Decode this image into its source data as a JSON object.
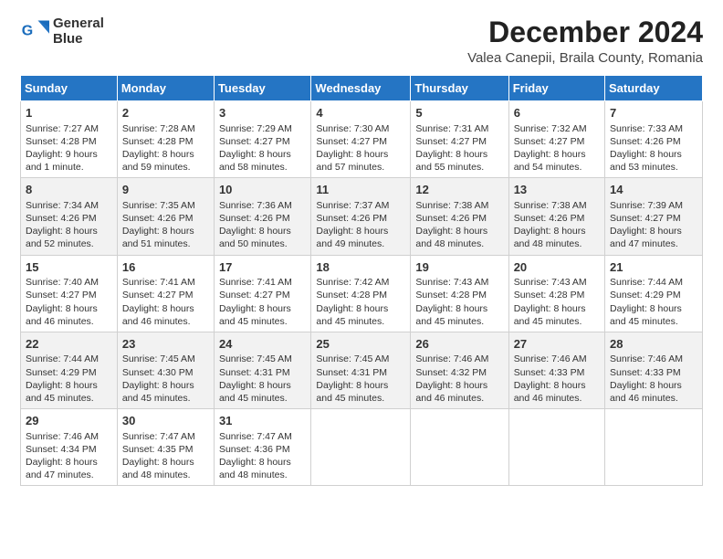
{
  "logo": {
    "line1": "General",
    "line2": "Blue"
  },
  "title": "December 2024",
  "subtitle": "Valea Canepii, Braila County, Romania",
  "header_days": [
    "Sunday",
    "Monday",
    "Tuesday",
    "Wednesday",
    "Thursday",
    "Friday",
    "Saturday"
  ],
  "weeks": [
    [
      {
        "day": "1",
        "info": "Sunrise: 7:27 AM\nSunset: 4:28 PM\nDaylight: 9 hours\nand 1 minute."
      },
      {
        "day": "2",
        "info": "Sunrise: 7:28 AM\nSunset: 4:28 PM\nDaylight: 8 hours\nand 59 minutes."
      },
      {
        "day": "3",
        "info": "Sunrise: 7:29 AM\nSunset: 4:27 PM\nDaylight: 8 hours\nand 58 minutes."
      },
      {
        "day": "4",
        "info": "Sunrise: 7:30 AM\nSunset: 4:27 PM\nDaylight: 8 hours\nand 57 minutes."
      },
      {
        "day": "5",
        "info": "Sunrise: 7:31 AM\nSunset: 4:27 PM\nDaylight: 8 hours\nand 55 minutes."
      },
      {
        "day": "6",
        "info": "Sunrise: 7:32 AM\nSunset: 4:27 PM\nDaylight: 8 hours\nand 54 minutes."
      },
      {
        "day": "7",
        "info": "Sunrise: 7:33 AM\nSunset: 4:26 PM\nDaylight: 8 hours\nand 53 minutes."
      }
    ],
    [
      {
        "day": "8",
        "info": "Sunrise: 7:34 AM\nSunset: 4:26 PM\nDaylight: 8 hours\nand 52 minutes."
      },
      {
        "day": "9",
        "info": "Sunrise: 7:35 AM\nSunset: 4:26 PM\nDaylight: 8 hours\nand 51 minutes."
      },
      {
        "day": "10",
        "info": "Sunrise: 7:36 AM\nSunset: 4:26 PM\nDaylight: 8 hours\nand 50 minutes."
      },
      {
        "day": "11",
        "info": "Sunrise: 7:37 AM\nSunset: 4:26 PM\nDaylight: 8 hours\nand 49 minutes."
      },
      {
        "day": "12",
        "info": "Sunrise: 7:38 AM\nSunset: 4:26 PM\nDaylight: 8 hours\nand 48 minutes."
      },
      {
        "day": "13",
        "info": "Sunrise: 7:38 AM\nSunset: 4:26 PM\nDaylight: 8 hours\nand 48 minutes."
      },
      {
        "day": "14",
        "info": "Sunrise: 7:39 AM\nSunset: 4:27 PM\nDaylight: 8 hours\nand 47 minutes."
      }
    ],
    [
      {
        "day": "15",
        "info": "Sunrise: 7:40 AM\nSunset: 4:27 PM\nDaylight: 8 hours\nand 46 minutes."
      },
      {
        "day": "16",
        "info": "Sunrise: 7:41 AM\nSunset: 4:27 PM\nDaylight: 8 hours\nand 46 minutes."
      },
      {
        "day": "17",
        "info": "Sunrise: 7:41 AM\nSunset: 4:27 PM\nDaylight: 8 hours\nand 45 minutes."
      },
      {
        "day": "18",
        "info": "Sunrise: 7:42 AM\nSunset: 4:28 PM\nDaylight: 8 hours\nand 45 minutes."
      },
      {
        "day": "19",
        "info": "Sunrise: 7:43 AM\nSunset: 4:28 PM\nDaylight: 8 hours\nand 45 minutes."
      },
      {
        "day": "20",
        "info": "Sunrise: 7:43 AM\nSunset: 4:28 PM\nDaylight: 8 hours\nand 45 minutes."
      },
      {
        "day": "21",
        "info": "Sunrise: 7:44 AM\nSunset: 4:29 PM\nDaylight: 8 hours\nand 45 minutes."
      }
    ],
    [
      {
        "day": "22",
        "info": "Sunrise: 7:44 AM\nSunset: 4:29 PM\nDaylight: 8 hours\nand 45 minutes."
      },
      {
        "day": "23",
        "info": "Sunrise: 7:45 AM\nSunset: 4:30 PM\nDaylight: 8 hours\nand 45 minutes."
      },
      {
        "day": "24",
        "info": "Sunrise: 7:45 AM\nSunset: 4:31 PM\nDaylight: 8 hours\nand 45 minutes."
      },
      {
        "day": "25",
        "info": "Sunrise: 7:45 AM\nSunset: 4:31 PM\nDaylight: 8 hours\nand 45 minutes."
      },
      {
        "day": "26",
        "info": "Sunrise: 7:46 AM\nSunset: 4:32 PM\nDaylight: 8 hours\nand 46 minutes."
      },
      {
        "day": "27",
        "info": "Sunrise: 7:46 AM\nSunset: 4:33 PM\nDaylight: 8 hours\nand 46 minutes."
      },
      {
        "day": "28",
        "info": "Sunrise: 7:46 AM\nSunset: 4:33 PM\nDaylight: 8 hours\nand 46 minutes."
      }
    ],
    [
      {
        "day": "29",
        "info": "Sunrise: 7:46 AM\nSunset: 4:34 PM\nDaylight: 8 hours\nand 47 minutes."
      },
      {
        "day": "30",
        "info": "Sunrise: 7:47 AM\nSunset: 4:35 PM\nDaylight: 8 hours\nand 48 minutes."
      },
      {
        "day": "31",
        "info": "Sunrise: 7:47 AM\nSunset: 4:36 PM\nDaylight: 8 hours\nand 48 minutes."
      },
      null,
      null,
      null,
      null
    ]
  ]
}
